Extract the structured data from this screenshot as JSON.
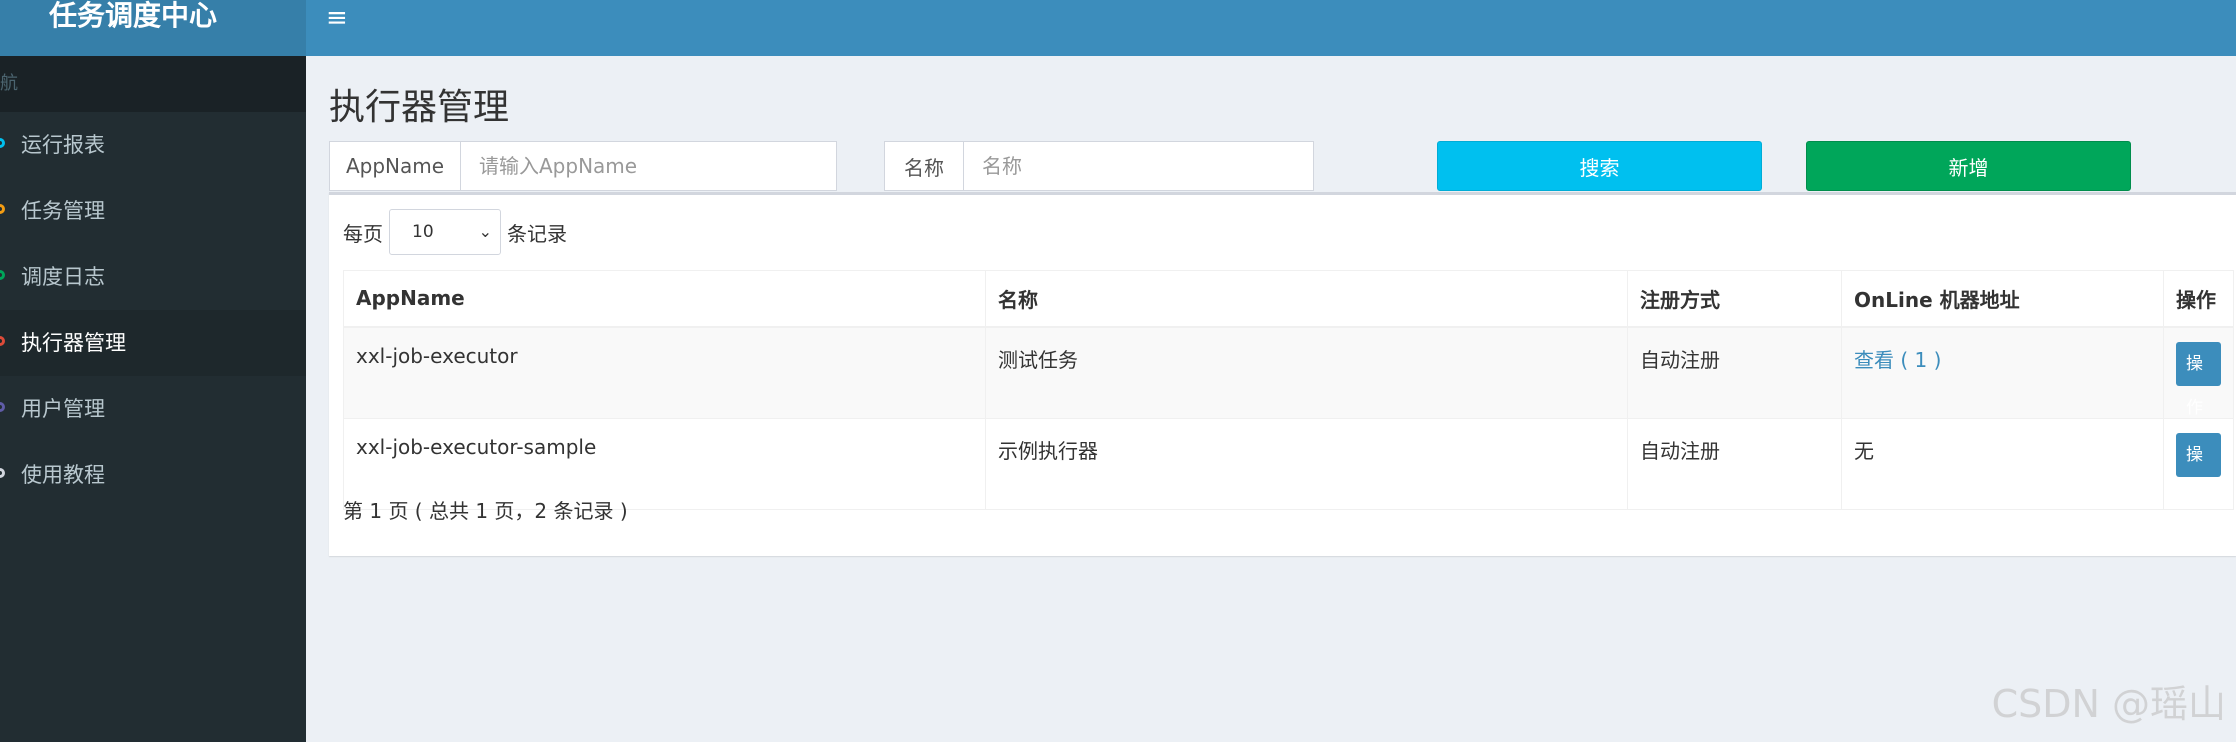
{
  "header": {
    "logo": "任务调度中心",
    "menu_toggle": "≡"
  },
  "sidebar": {
    "header": "航",
    "items": [
      {
        "label": "运行报表",
        "dot_color": "#00c0ef"
      },
      {
        "label": "任务管理",
        "dot_color": "#f39c12"
      },
      {
        "label": "调度日志",
        "dot_color": "#00a65a"
      },
      {
        "label": "执行器管理",
        "dot_color": "#dd4b39",
        "active": true
      },
      {
        "label": "用户管理",
        "dot_color": "#605ca8"
      },
      {
        "label": "使用教程",
        "dot_color": "#d2d6de"
      }
    ]
  },
  "main": {
    "title": "执行器管理",
    "filters": {
      "appname_label": "AppName",
      "appname_placeholder": "请输入AppName",
      "name_label": "名称",
      "name_placeholder": "名称",
      "search_button": "搜索",
      "add_button": "新增"
    },
    "length": {
      "prefix": "每页",
      "value": "10",
      "suffix": "条记录"
    },
    "table": {
      "columns": [
        "AppName",
        "名称",
        "注册方式",
        "OnLine 机器地址",
        "操作"
      ],
      "rows": [
        {
          "appname": "xxl-job-executor",
          "name": "测试任务",
          "reg": "自动注册",
          "online": "查看 ( 1 )",
          "op": "操作"
        },
        {
          "appname": "xxl-job-executor-sample",
          "name": "示例执行器",
          "reg": "自动注册",
          "online": "无",
          "op": "操作"
        }
      ]
    },
    "info": "第 1 页 ( 总共 1 页，2 条记录 )"
  },
  "watermark": "CSDN @瑶山",
  "colors": {
    "header": "#3c8dbc",
    "logo": "#367fa9",
    "sidebar": "#222d32",
    "search_button": "#00c0ef",
    "add_button": "#00a65a",
    "link": "#3c8dbc"
  }
}
